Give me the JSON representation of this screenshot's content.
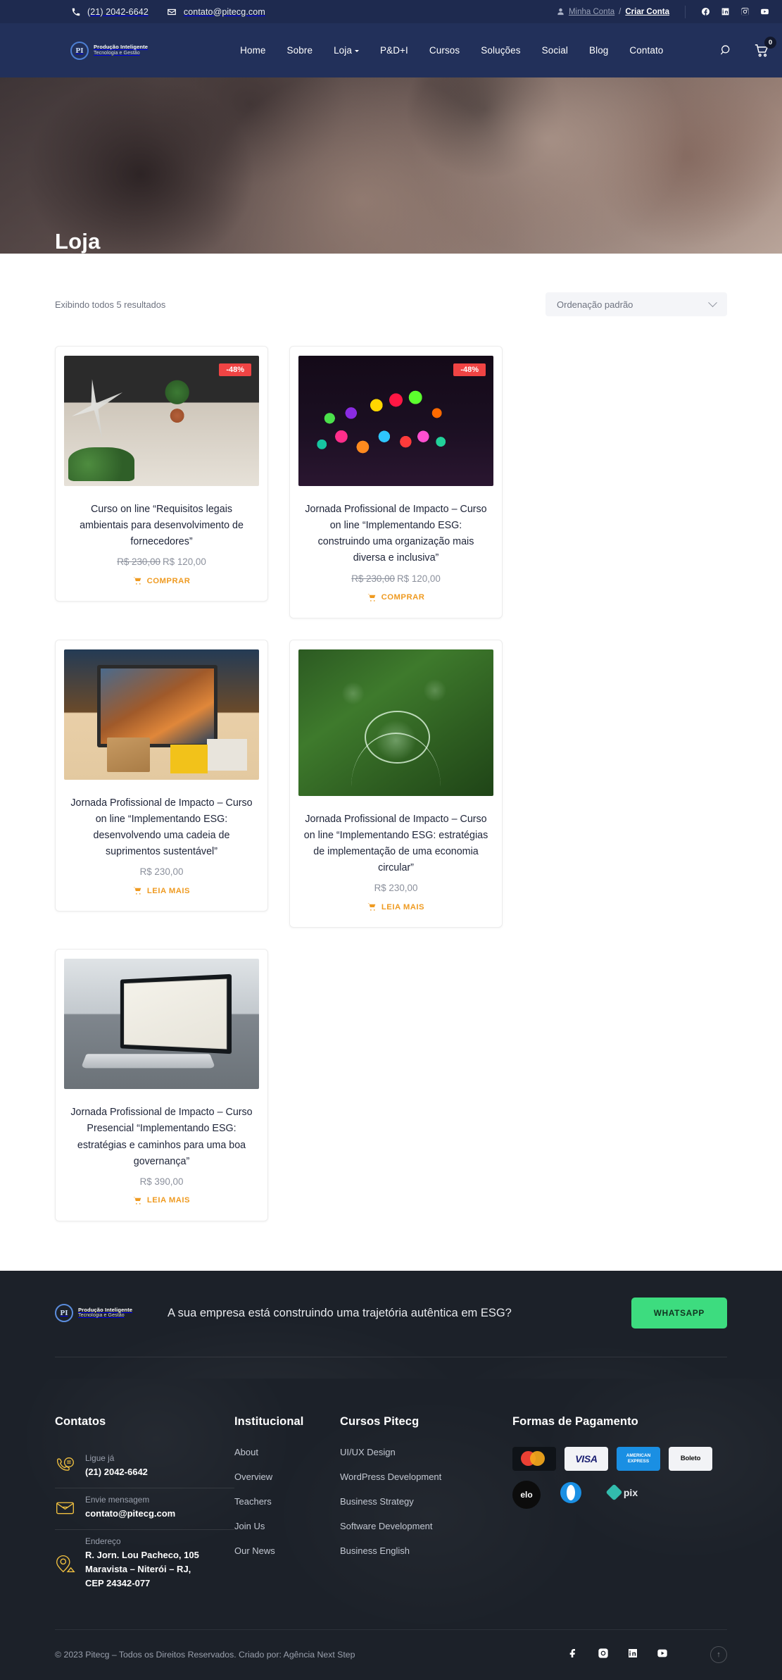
{
  "topbar": {
    "phone": "(21) 2042-6642",
    "email": "contato@pitecg.com",
    "account_link": "Minha Conta",
    "account_sep": "/",
    "account_create": "Criar Conta",
    "socials": [
      "facebook-icon",
      "linkedin-icon",
      "instagram-icon",
      "youtube-icon"
    ]
  },
  "nav": {
    "logo_line1": "Produção Inteligente",
    "logo_line2": "Tecnologia e Gestão",
    "logo_mark": "PI",
    "items": [
      {
        "label": "Home",
        "has_caret": false
      },
      {
        "label": "Sobre",
        "has_caret": false
      },
      {
        "label": "Loja",
        "has_caret": true
      },
      {
        "label": "P&D+I",
        "has_caret": false
      },
      {
        "label": "Cursos",
        "has_caret": false
      },
      {
        "label": "Soluções",
        "has_caret": false
      },
      {
        "label": "Social",
        "has_caret": false
      },
      {
        "label": "Blog",
        "has_caret": false
      },
      {
        "label": "Contato",
        "has_caret": false
      }
    ],
    "search_icon": "search-icon",
    "cart_icon": "cart-icon",
    "cart_count": "0"
  },
  "hero": {
    "title": "Loja"
  },
  "shop": {
    "result_count": "Exibindo todos 5 resultados",
    "sort_value": "Ordenação padrão",
    "sort_options": [
      "Ordenação padrão"
    ],
    "products": [
      {
        "title": "Curso on line “Requisitos legais ambientais para desenvolvimento de fornecedores”",
        "badge": "-48%",
        "price_old": "R$ 230,00",
        "price_new": "R$ 120,00",
        "action": "COMPRAR",
        "thumb": "architecture-model-desk-photo"
      },
      {
        "title": "Jornada Profissional de Impacto – Curso on line “Implementando ESG: construindo uma organização mais diversa e inclusiva”",
        "badge": "-48%",
        "price_old": "R$ 230,00",
        "price_new": "R$ 120,00",
        "action": "COMPRAR",
        "thumb": "colorful-pens-photo"
      },
      {
        "title": "Jornada Profissional de Impacto – Curso on line “Implementando ESG: desenvolvendo uma cadeia de suprimentos sustentável”",
        "badge": "",
        "price_old": "",
        "price_new": "R$ 230,00",
        "action": "LEIA MAIS",
        "thumb": "supply-chain-laptop-photo"
      },
      {
        "title": "Jornada Profissional de Impacto – Curso on line “Implementando ESG: estratégias de implementação de uma economia circular”",
        "badge": "",
        "price_old": "",
        "price_new": "R$ 230,00",
        "action": "LEIA MAIS",
        "thumb": "eco-globe-hand-photo"
      },
      {
        "title": "Jornada Profissional de Impacto – Curso Presencial “Implementando ESG: estratégias e caminhos para uma boa governança”",
        "badge": "",
        "price_old": "",
        "price_new": "R$ 390,00",
        "action": "LEIA MAIS",
        "thumb": "laptop-dashboard-photo"
      }
    ]
  },
  "cta": {
    "logo_line1": "Produção Inteligente",
    "logo_line2": "Tecnologia e Gestão",
    "logo_mark": "PI",
    "text": "A sua empresa está construindo uma trajetória autêntica em ESG?",
    "button": "WHATSAPP"
  },
  "footer": {
    "contacts": {
      "heading": "Contatos",
      "rows": [
        {
          "icon": "phone-message-icon",
          "label": "Ligue já",
          "value": "(21) 2042-6642"
        },
        {
          "icon": "envelope-icon",
          "label": "Envie mensagem",
          "value": "contato@pitecg.com"
        },
        {
          "icon": "map-pin-icon",
          "label": "Endereço",
          "value": "R. Jorn. Lou Pacheco, 105 Maravista – Niterói – RJ, CEP 24342-077"
        }
      ]
    },
    "institucional": {
      "heading": "Institucional",
      "links": [
        "About",
        "Overview",
        "Teachers",
        "Join Us",
        "Our News"
      ]
    },
    "cursos": {
      "heading": "Cursos Pitecg",
      "links": [
        "UI/UX Design",
        "WordPress Development",
        "Business Strategy",
        "Software Development",
        "Business English"
      ]
    },
    "payments": {
      "heading": "Formas de Pagamento",
      "methods": [
        "Mastercard",
        "VISA",
        "AMERICAN EXPRESS",
        "Boleto",
        "elo",
        "Diners Club",
        "pix"
      ]
    },
    "copyright": "© 2023 Pitecg – Todos os Direitos Reservados. Criado por: Agência Next Step",
    "socials": [
      "facebook-icon",
      "instagram-icon",
      "linkedin-icon",
      "youtube-icon"
    ],
    "to_top": "to-top-icon"
  },
  "colors": {
    "topbar_bg": "#1e2a4f",
    "nav_bg": "#22305a",
    "accent_orange": "#ef9b22",
    "badge_red": "#f04444",
    "whatsapp_green": "#3ddc7f",
    "footer_bg": "#1c2129",
    "footer_icon_yellow": "#f0c040"
  }
}
